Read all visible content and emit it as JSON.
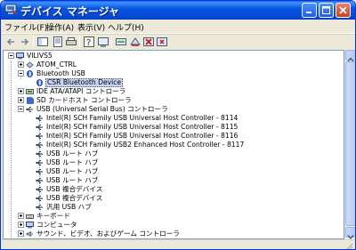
{
  "window": {
    "title": "デバイス マネージャ",
    "icon": "device-manager-icon",
    "colors": {
      "titlebar": "#0a55dd",
      "close": "#d9572b"
    }
  },
  "menubar": {
    "items": [
      {
        "label": "ファイル(F)"
      },
      {
        "label": "操作(A)"
      },
      {
        "label": "表示(V)"
      },
      {
        "label": "ヘルプ(H)"
      }
    ]
  },
  "toolbar": {
    "icons": [
      "back-icon",
      "forward-icon",
      "show-hide-tree-icon",
      "properties-icon",
      "print-icon",
      "help-icon",
      "update-driver-icon",
      "scan-hardware-icon",
      "disable-device-icon",
      "uninstall-icon"
    ]
  },
  "tree": {
    "root": {
      "label": "VILIVS5",
      "icon": "computer-icon"
    },
    "items": [
      {
        "label": "ATOM_CTRL",
        "icon": "device-icon"
      },
      {
        "label": "Bluetooth USB",
        "icon": "bluetooth-icon"
      },
      {
        "label": "CSR Bluetooth Device",
        "icon": "bluetooth-icon",
        "selected": true
      },
      {
        "label": "IDE ATA/ATAPI コントローラ",
        "icon": "ide-icon"
      },
      {
        "label": "SD カードホスト コントローラ",
        "icon": "sd-card-icon"
      },
      {
        "label": "USB (Universal Serial Bus) コントローラ",
        "icon": "usb-icon"
      },
      {
        "label": "Intel(R) SCH Family USB Universal Host Controller - 8114",
        "icon": "usb-icon"
      },
      {
        "label": "Intel(R) SCH Family USB Universal Host Controller - 8115",
        "icon": "usb-icon"
      },
      {
        "label": "Intel(R) SCH Family USB Universal Host Controller - 8116",
        "icon": "usb-icon"
      },
      {
        "label": "Intel(R) SCH Family USB2 Enhanced Host Controller - 8117",
        "icon": "usb-icon"
      },
      {
        "label": "USB ルート ハブ",
        "icon": "usb-icon"
      },
      {
        "label": "USB ルート ハブ",
        "icon": "usb-icon"
      },
      {
        "label": "USB ルート ハブ",
        "icon": "usb-icon"
      },
      {
        "label": "USB ルート ハブ",
        "icon": "usb-icon"
      },
      {
        "label": "USB 複合デバイス",
        "icon": "usb-icon"
      },
      {
        "label": "USB 複合デバイス",
        "icon": "usb-icon"
      },
      {
        "label": "汎用 USB ハブ",
        "icon": "usb-icon"
      },
      {
        "label": "キーボード",
        "icon": "keyboard-icon"
      },
      {
        "label": "コンピュータ",
        "icon": "computer-icon"
      },
      {
        "label": "サウンド、ビデオ、およびゲーム コントローラ",
        "icon": "sound-icon"
      }
    ]
  }
}
